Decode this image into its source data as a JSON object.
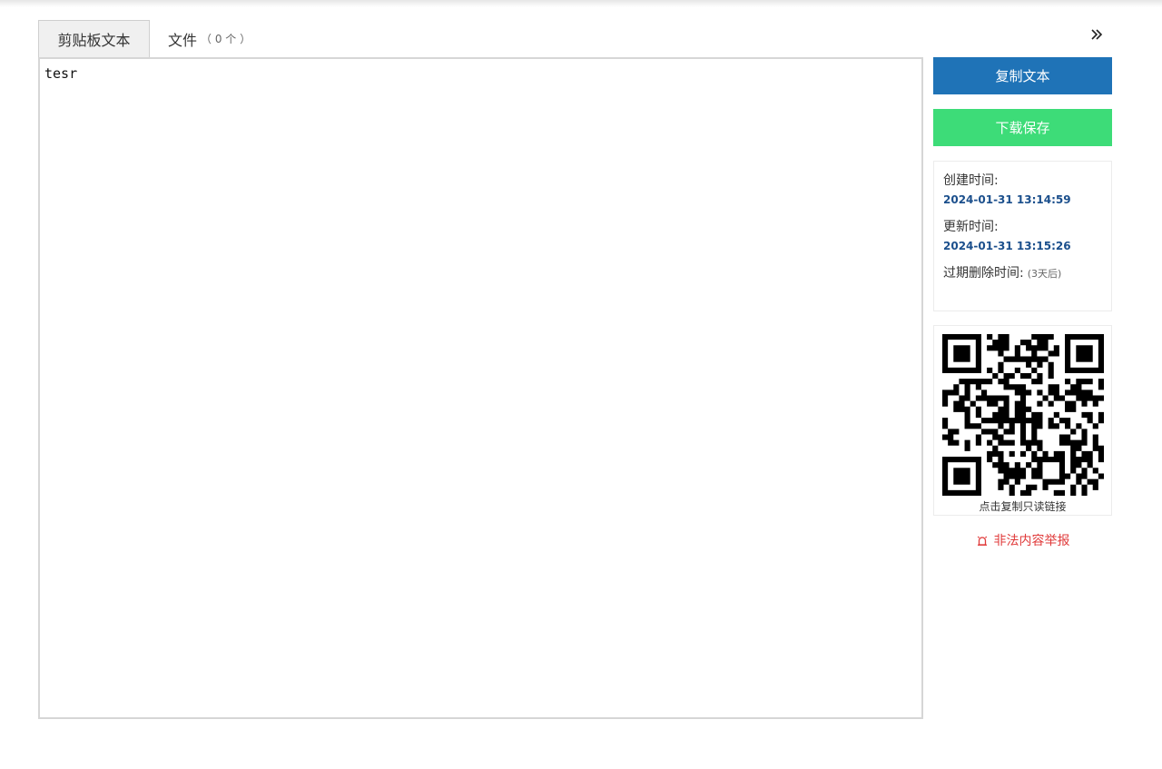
{
  "tabs": [
    {
      "label": "剪贴板文本",
      "active": true
    },
    {
      "label": "文件",
      "count": "（ 0 个 ）",
      "active": false
    }
  ],
  "icons": {
    "collapse": "double-chevron-right-icon",
    "report": "alarm-icon"
  },
  "editor": {
    "value": "tesr"
  },
  "actions": {
    "copy_label": "复制文本",
    "download_label": "下载保存"
  },
  "info": {
    "created_label": "创建时间:",
    "created_value": "2024-01-31 13:14:59",
    "updated_label": "更新时间:",
    "updated_value": "2024-01-31 13:15:26",
    "expire_label": "过期删除时间:",
    "expire_note": "(3天后)"
  },
  "qr": {
    "caption": "点击复制只读链接"
  },
  "report": {
    "label": "非法内容举报"
  },
  "colors": {
    "primary": "#1f73b7",
    "success": "#3ddc78",
    "time_value": "#1b4f8c",
    "danger": "#e03a3a"
  }
}
